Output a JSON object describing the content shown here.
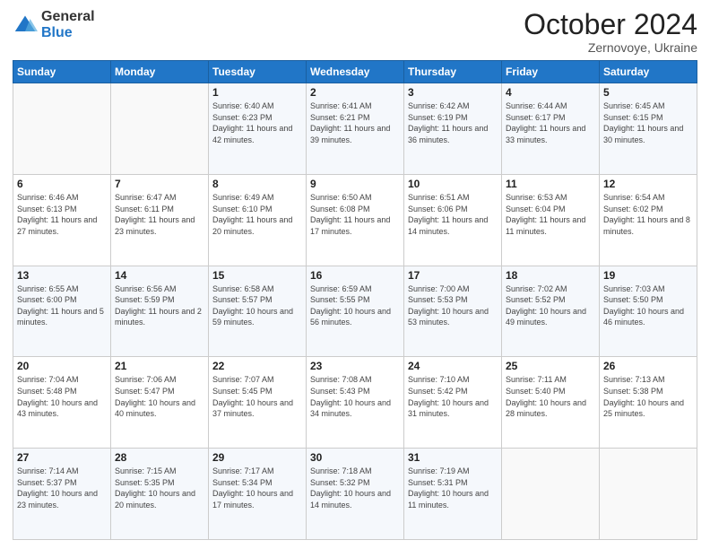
{
  "logo": {
    "general": "General",
    "blue": "Blue"
  },
  "header": {
    "month": "October 2024",
    "location": "Zernovoye, Ukraine"
  },
  "weekdays": [
    "Sunday",
    "Monday",
    "Tuesday",
    "Wednesday",
    "Thursday",
    "Friday",
    "Saturday"
  ],
  "weeks": [
    [
      {
        "day": "",
        "sunrise": "",
        "sunset": "",
        "daylight": ""
      },
      {
        "day": "",
        "sunrise": "",
        "sunset": "",
        "daylight": ""
      },
      {
        "day": "1",
        "sunrise": "Sunrise: 6:40 AM",
        "sunset": "Sunset: 6:23 PM",
        "daylight": "Daylight: 11 hours and 42 minutes."
      },
      {
        "day": "2",
        "sunrise": "Sunrise: 6:41 AM",
        "sunset": "Sunset: 6:21 PM",
        "daylight": "Daylight: 11 hours and 39 minutes."
      },
      {
        "day": "3",
        "sunrise": "Sunrise: 6:42 AM",
        "sunset": "Sunset: 6:19 PM",
        "daylight": "Daylight: 11 hours and 36 minutes."
      },
      {
        "day": "4",
        "sunrise": "Sunrise: 6:44 AM",
        "sunset": "Sunset: 6:17 PM",
        "daylight": "Daylight: 11 hours and 33 minutes."
      },
      {
        "day": "5",
        "sunrise": "Sunrise: 6:45 AM",
        "sunset": "Sunset: 6:15 PM",
        "daylight": "Daylight: 11 hours and 30 minutes."
      }
    ],
    [
      {
        "day": "6",
        "sunrise": "Sunrise: 6:46 AM",
        "sunset": "Sunset: 6:13 PM",
        "daylight": "Daylight: 11 hours and 27 minutes."
      },
      {
        "day": "7",
        "sunrise": "Sunrise: 6:47 AM",
        "sunset": "Sunset: 6:11 PM",
        "daylight": "Daylight: 11 hours and 23 minutes."
      },
      {
        "day": "8",
        "sunrise": "Sunrise: 6:49 AM",
        "sunset": "Sunset: 6:10 PM",
        "daylight": "Daylight: 11 hours and 20 minutes."
      },
      {
        "day": "9",
        "sunrise": "Sunrise: 6:50 AM",
        "sunset": "Sunset: 6:08 PM",
        "daylight": "Daylight: 11 hours and 17 minutes."
      },
      {
        "day": "10",
        "sunrise": "Sunrise: 6:51 AM",
        "sunset": "Sunset: 6:06 PM",
        "daylight": "Daylight: 11 hours and 14 minutes."
      },
      {
        "day": "11",
        "sunrise": "Sunrise: 6:53 AM",
        "sunset": "Sunset: 6:04 PM",
        "daylight": "Daylight: 11 hours and 11 minutes."
      },
      {
        "day": "12",
        "sunrise": "Sunrise: 6:54 AM",
        "sunset": "Sunset: 6:02 PM",
        "daylight": "Daylight: 11 hours and 8 minutes."
      }
    ],
    [
      {
        "day": "13",
        "sunrise": "Sunrise: 6:55 AM",
        "sunset": "Sunset: 6:00 PM",
        "daylight": "Daylight: 11 hours and 5 minutes."
      },
      {
        "day": "14",
        "sunrise": "Sunrise: 6:56 AM",
        "sunset": "Sunset: 5:59 PM",
        "daylight": "Daylight: 11 hours and 2 minutes."
      },
      {
        "day": "15",
        "sunrise": "Sunrise: 6:58 AM",
        "sunset": "Sunset: 5:57 PM",
        "daylight": "Daylight: 10 hours and 59 minutes."
      },
      {
        "day": "16",
        "sunrise": "Sunrise: 6:59 AM",
        "sunset": "Sunset: 5:55 PM",
        "daylight": "Daylight: 10 hours and 56 minutes."
      },
      {
        "day": "17",
        "sunrise": "Sunrise: 7:00 AM",
        "sunset": "Sunset: 5:53 PM",
        "daylight": "Daylight: 10 hours and 53 minutes."
      },
      {
        "day": "18",
        "sunrise": "Sunrise: 7:02 AM",
        "sunset": "Sunset: 5:52 PM",
        "daylight": "Daylight: 10 hours and 49 minutes."
      },
      {
        "day": "19",
        "sunrise": "Sunrise: 7:03 AM",
        "sunset": "Sunset: 5:50 PM",
        "daylight": "Daylight: 10 hours and 46 minutes."
      }
    ],
    [
      {
        "day": "20",
        "sunrise": "Sunrise: 7:04 AM",
        "sunset": "Sunset: 5:48 PM",
        "daylight": "Daylight: 10 hours and 43 minutes."
      },
      {
        "day": "21",
        "sunrise": "Sunrise: 7:06 AM",
        "sunset": "Sunset: 5:47 PM",
        "daylight": "Daylight: 10 hours and 40 minutes."
      },
      {
        "day": "22",
        "sunrise": "Sunrise: 7:07 AM",
        "sunset": "Sunset: 5:45 PM",
        "daylight": "Daylight: 10 hours and 37 minutes."
      },
      {
        "day": "23",
        "sunrise": "Sunrise: 7:08 AM",
        "sunset": "Sunset: 5:43 PM",
        "daylight": "Daylight: 10 hours and 34 minutes."
      },
      {
        "day": "24",
        "sunrise": "Sunrise: 7:10 AM",
        "sunset": "Sunset: 5:42 PM",
        "daylight": "Daylight: 10 hours and 31 minutes."
      },
      {
        "day": "25",
        "sunrise": "Sunrise: 7:11 AM",
        "sunset": "Sunset: 5:40 PM",
        "daylight": "Daylight: 10 hours and 28 minutes."
      },
      {
        "day": "26",
        "sunrise": "Sunrise: 7:13 AM",
        "sunset": "Sunset: 5:38 PM",
        "daylight": "Daylight: 10 hours and 25 minutes."
      }
    ],
    [
      {
        "day": "27",
        "sunrise": "Sunrise: 7:14 AM",
        "sunset": "Sunset: 5:37 PM",
        "daylight": "Daylight: 10 hours and 23 minutes."
      },
      {
        "day": "28",
        "sunrise": "Sunrise: 7:15 AM",
        "sunset": "Sunset: 5:35 PM",
        "daylight": "Daylight: 10 hours and 20 minutes."
      },
      {
        "day": "29",
        "sunrise": "Sunrise: 7:17 AM",
        "sunset": "Sunset: 5:34 PM",
        "daylight": "Daylight: 10 hours and 17 minutes."
      },
      {
        "day": "30",
        "sunrise": "Sunrise: 7:18 AM",
        "sunset": "Sunset: 5:32 PM",
        "daylight": "Daylight: 10 hours and 14 minutes."
      },
      {
        "day": "31",
        "sunrise": "Sunrise: 7:19 AM",
        "sunset": "Sunset: 5:31 PM",
        "daylight": "Daylight: 10 hours and 11 minutes."
      },
      {
        "day": "",
        "sunrise": "",
        "sunset": "",
        "daylight": ""
      },
      {
        "day": "",
        "sunrise": "",
        "sunset": "",
        "daylight": ""
      }
    ]
  ]
}
